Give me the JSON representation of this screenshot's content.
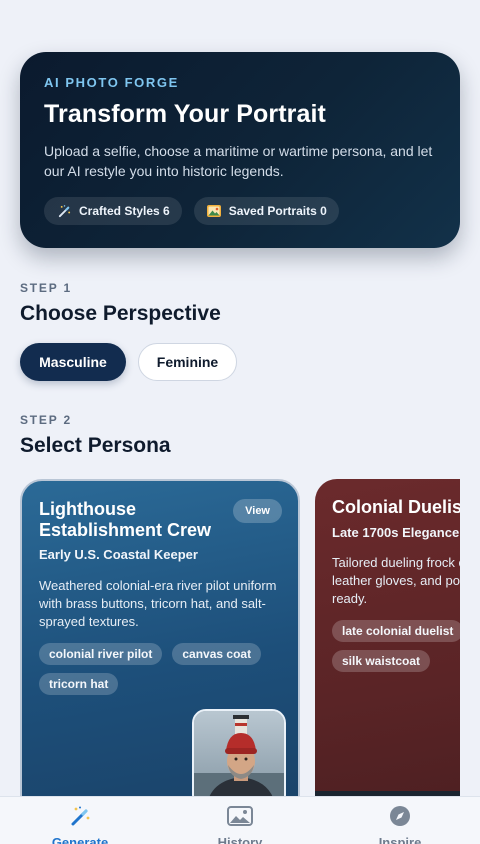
{
  "hero": {
    "eyebrow": "AI PHOTO FORGE",
    "title": "Transform Your Portrait",
    "description": "Upload a selfie, choose a maritime or wartime persona, and let our AI restyle you into historic legends.",
    "chips": [
      {
        "label": "Crafted Styles 6",
        "icon": "magic-wand-icon"
      },
      {
        "label": "Saved Portraits 0",
        "icon": "picture-icon"
      }
    ]
  },
  "step1": {
    "label": "STEP 1",
    "title": "Choose Perspective",
    "options": [
      "Masculine",
      "Feminine"
    ],
    "selected": "Masculine"
  },
  "step2": {
    "label": "STEP 2",
    "title": "Select Persona",
    "cards": [
      {
        "title": "Lighthouse Establishment Crew",
        "subtitle": "Early U.S. Coastal Keeper",
        "description": "Weathered colonial-era river pilot uniform with brass buttons, tricorn hat, and salt-sprayed textures.",
        "tags": [
          "colonial river pilot",
          "canvas coat",
          "tricorn hat"
        ],
        "view_label": "View"
      },
      {
        "title": "Colonial Duelis",
        "subtitle": "Late 1700s Elegance",
        "description_lines": [
          "Tailored dueling frock c",
          "leather gloves, and po",
          "ready."
        ],
        "tags": [
          "late colonial duelist",
          "silk waistcoat"
        ]
      }
    ]
  },
  "nav": {
    "items": [
      {
        "label": "Generate",
        "icon": "magic-wand-icon",
        "active": true
      },
      {
        "label": "History",
        "icon": "gallery-icon",
        "active": false
      },
      {
        "label": "Inspire",
        "icon": "compass-icon",
        "active": false
      }
    ]
  },
  "colors": {
    "accent": "#1f74cc",
    "hero_bg": "#0e2438",
    "card_a": "#1d4f7a",
    "card_b": "#5a2426",
    "toggle_active": "#122c4f"
  }
}
